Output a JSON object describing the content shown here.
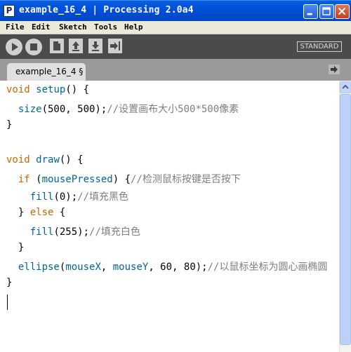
{
  "window": {
    "app_icon_letter": "P",
    "title": "example_16_4 | Processing 2.0a4"
  },
  "menu": [
    "File",
    "Edit",
    "Sketch",
    "Tools",
    "Help"
  ],
  "toolbar": {
    "mode": "STANDARD"
  },
  "tabs": [
    {
      "label": "example_16_4 §"
    }
  ],
  "editor": {
    "line1": {
      "kw": "void",
      "fn": "setup",
      "rest": "() {"
    },
    "line2": {
      "fn": "size",
      "code": "(500, 500);",
      "comment": "//设置画布大小500*500像素"
    },
    "line3": "}",
    "line5": {
      "kw": "void",
      "fn": "draw",
      "rest": "() {"
    },
    "line6": {
      "kw": "if",
      "paren": " (",
      "var": "mousePressed",
      "code": ") {",
      "comment": "//检测鼠标按键是否按下"
    },
    "line7": {
      "fn": "fill",
      "code": "(0);",
      "comment": "//填充黑色"
    },
    "line8": {
      "code1": "} ",
      "kw": "else",
      "code2": " {"
    },
    "line9": {
      "fn": "fill",
      "code": "(255);",
      "comment": "//填充白色"
    },
    "line10": "}",
    "line11": {
      "fn": "ellipse",
      "code1": "(",
      "var1": "mouseX",
      "code2": ", ",
      "var2": "mouseY",
      "code3": ", 60, 80);",
      "comment": "//以鼠标坐标为圆心画椭圆"
    },
    "line12": "}"
  },
  "colors": {
    "keyword": "#cc6600",
    "function": "#006699",
    "comment": "#7e7e7e",
    "toolbar_bg": "#4b4b4b",
    "tabbar_bg": "#9a9a9a"
  }
}
